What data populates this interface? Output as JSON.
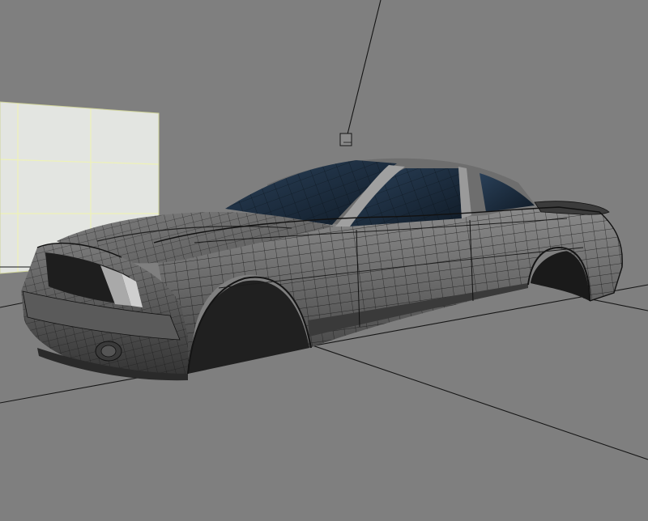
{
  "viewport": {
    "kind": "3d-modeling-viewport",
    "subject": "car-body-wireframe-mesh",
    "display_mode": "shaded-with-wireframe"
  },
  "colors": {
    "background": "#7f7f7f",
    "floor_lines": "#1a1a1a",
    "backdrop_plane": "#e4e6e2",
    "backdrop_grid": "#f0f3c8",
    "body_shade": "#5c5c5c",
    "body_highlight": "#9a9a9a",
    "body_dark": "#2a2a2a",
    "glass": "#1c2e40",
    "wire": "#111111"
  }
}
